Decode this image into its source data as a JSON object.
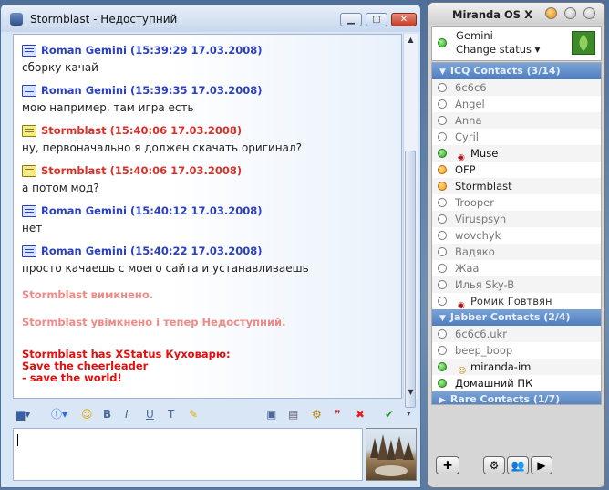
{
  "chat": {
    "title": "Stormblast - Недоступний",
    "messages": [
      {
        "dir": "in",
        "header": "Roman Gemini (15:39:29 17.03.2008)",
        "text": "сборку качай"
      },
      {
        "dir": "in",
        "header": "Roman Gemini (15:39:35 17.03.2008)",
        "text": "мою например. там игра есть"
      },
      {
        "dir": "out",
        "header": "Stormblast (15:40:06 17.03.2008)",
        "text": "ну, первоначально я должен скачать оригинал?"
      },
      {
        "dir": "out",
        "header": "Stormblast (15:40:06 17.03.2008)",
        "text": "а потом мод?"
      },
      {
        "dir": "in",
        "header": "Roman Gemini (15:40:12 17.03.2008)",
        "text": "нет"
      },
      {
        "dir": "in",
        "header": "Roman Gemini (15:40:22 17.03.2008)",
        "text": "просто качаешь с моего сайта и устанавливаешь"
      }
    ],
    "status_events": [
      "Stormblast вимкнено.",
      "Stormblast увімкнено і тепер Недоступний."
    ],
    "xstatus_lines": [
      "Stormblast has XStatus Куховарю:",
      "Save the cheerleader",
      "- save the world!"
    ]
  },
  "contacts": {
    "title": "Miranda OS X",
    "me": {
      "name": "Gemini",
      "status": "Change status ▾"
    },
    "groups": [
      {
        "name": "ICQ Contacts (3/14)",
        "contacts": [
          {
            "name": "6c6c6",
            "status": "off"
          },
          {
            "name": "Angel",
            "status": "off"
          },
          {
            "name": "Anna",
            "status": "off"
          },
          {
            "name": "Cyril",
            "status": "off"
          },
          {
            "name": "Muse",
            "status": "on",
            "xicon": "radio"
          },
          {
            "name": "OFP",
            "status": "na"
          },
          {
            "name": "Stormblast",
            "status": "na"
          },
          {
            "name": "Trooper",
            "status": "off"
          },
          {
            "name": "Viruspsyh",
            "status": "off"
          },
          {
            "name": "wovchyk",
            "status": "off"
          },
          {
            "name": "Вадяко",
            "status": "off"
          },
          {
            "name": "Жаа",
            "status": "off"
          },
          {
            "name": "Илья Sky-B",
            "status": "off"
          },
          {
            "name": "Ромик Говтвян",
            "status": "off",
            "xicon": "radio"
          }
        ]
      },
      {
        "name": "Jabber Contacts (2/4)",
        "contacts": [
          {
            "name": "6c6c6.ukr",
            "status": "off"
          },
          {
            "name": "beep_boop",
            "status": "off"
          },
          {
            "name": "miranda-im",
            "status": "on",
            "xicon": "smile"
          },
          {
            "name": "Домашний ПК",
            "status": "on"
          }
        ]
      },
      {
        "name": "Rare Contacts (1/7)",
        "contacts": []
      }
    ]
  }
}
